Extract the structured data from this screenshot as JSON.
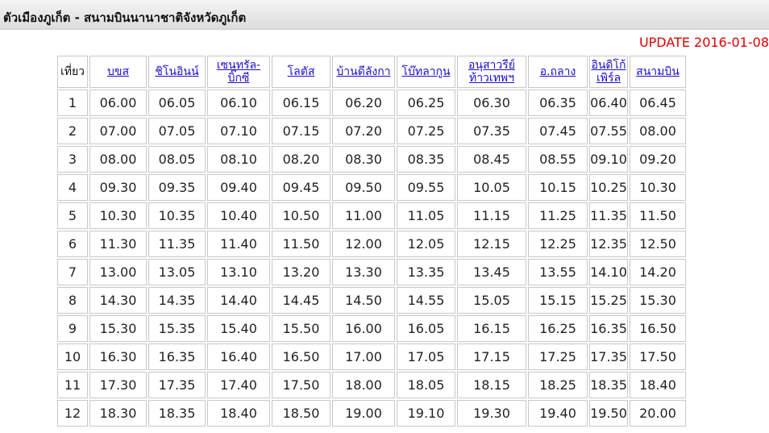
{
  "header": {
    "title": "ตัวเมืองภูเก็ต - สนามบินนานาชาติจังหวัดภูเก็ต"
  },
  "update_label": "UPDATE 2016-01-08",
  "table": {
    "trip_header": "เที่ยว",
    "stops": [
      {
        "line1": "บขส",
        "line2": ""
      },
      {
        "line1": "ชิโนอินน์",
        "line2": ""
      },
      {
        "line1": "เซนทรัล-",
        "line2": "บิ๊กซี"
      },
      {
        "line1": "โลตัส",
        "line2": ""
      },
      {
        "line1": "บ้านดีลังกา",
        "line2": ""
      },
      {
        "line1": "โบ๊ทลากูน",
        "line2": ""
      },
      {
        "line1": "อนุสาวรีย์",
        "line2": "ท้าวเทพฯ"
      },
      {
        "line1": "อ.ถลาง",
        "line2": ""
      },
      {
        "line1": "อินดิโก้",
        "line2": "เพิร์ล"
      },
      {
        "line1": "สนามบิน",
        "line2": ""
      }
    ],
    "rows": [
      {
        "trip": "1",
        "times": [
          "06.00",
          "06.05",
          "06.10",
          "06.15",
          "06.20",
          "06.25",
          "06.30",
          "06.35",
          "06.40",
          "06.45"
        ]
      },
      {
        "trip": "2",
        "times": [
          "07.00",
          "07.05",
          "07.10",
          "07.15",
          "07.20",
          "07.25",
          "07.35",
          "07.45",
          "07.55",
          "08.00"
        ]
      },
      {
        "trip": "3",
        "times": [
          "08.00",
          "08.05",
          "08.10",
          "08.20",
          "08.30",
          "08.35",
          "08.45",
          "08.55",
          "09.10",
          "09.20"
        ]
      },
      {
        "trip": "4",
        "times": [
          "09.30",
          "09.35",
          "09.40",
          "09.45",
          "09.50",
          "09.55",
          "10.05",
          "10.15",
          "10.25",
          "10.30"
        ]
      },
      {
        "trip": "5",
        "times": [
          "10.30",
          "10.35",
          "10.40",
          "10.50",
          "11.00",
          "11.05",
          "11.15",
          "11.25",
          "11.35",
          "11.50"
        ]
      },
      {
        "trip": "6",
        "times": [
          "11.30",
          "11.35",
          "11.40",
          "11.50",
          "12.00",
          "12.05",
          "12.15",
          "12.25",
          "12.35",
          "12.50"
        ]
      },
      {
        "trip": "7",
        "times": [
          "13.00",
          "13.05",
          "13.10",
          "13.20",
          "13.30",
          "13.35",
          "13.45",
          "13.55",
          "14.10",
          "14.20"
        ]
      },
      {
        "trip": "8",
        "times": [
          "14.30",
          "14.35",
          "14.40",
          "14.45",
          "14.50",
          "14.55",
          "15.05",
          "15.15",
          "15.25",
          "15.30"
        ]
      },
      {
        "trip": "9",
        "times": [
          "15.30",
          "15.35",
          "15.40",
          "15.50",
          "16.00",
          "16.05",
          "16.15",
          "16.25",
          "16.35",
          "16.50"
        ]
      },
      {
        "trip": "10",
        "times": [
          "16.30",
          "16.35",
          "16.40",
          "16.50",
          "17.00",
          "17.05",
          "17.15",
          "17.25",
          "17.35",
          "17.50"
        ]
      },
      {
        "trip": "11",
        "times": [
          "17.30",
          "17.35",
          "17.40",
          "17.50",
          "18.00",
          "18.05",
          "18.15",
          "18.25",
          "18.35",
          "18.40"
        ]
      },
      {
        "trip": "12",
        "times": [
          "18.30",
          "18.35",
          "18.40",
          "18.50",
          "19.00",
          "19.10",
          "19.30",
          "19.40",
          "19.50",
          "20.00"
        ]
      }
    ]
  },
  "colors": {
    "link": "#1a0dcc",
    "update": "#e00000",
    "cell_border": "#c8c8c8"
  }
}
